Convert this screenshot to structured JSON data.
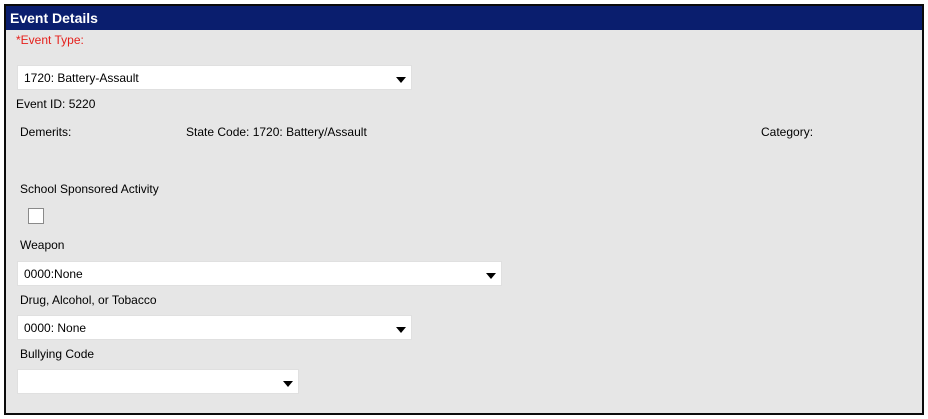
{
  "panel": {
    "title": "Event Details"
  },
  "event_type": {
    "label": "*Event Type:",
    "value": "1720: Battery-Assault"
  },
  "event_id": "Event ID: 5220",
  "info_row": {
    "demerits": "Demerits:",
    "state_code": "State Code: 1720: Battery/Assault",
    "category": "Category:"
  },
  "school_sponsored": {
    "label": "School Sponsored Activity",
    "checked": false
  },
  "weapon": {
    "label": "Weapon",
    "value": "0000:None"
  },
  "drug": {
    "label": "Drug, Alcohol, or Tobacco",
    "value": "0000: None"
  },
  "bullying": {
    "label": "Bullying Code",
    "value": ""
  },
  "colors": {
    "title_bar": "#0a1e6e",
    "panel_background": "#e6e6e6",
    "required_label": "#e5201c"
  }
}
